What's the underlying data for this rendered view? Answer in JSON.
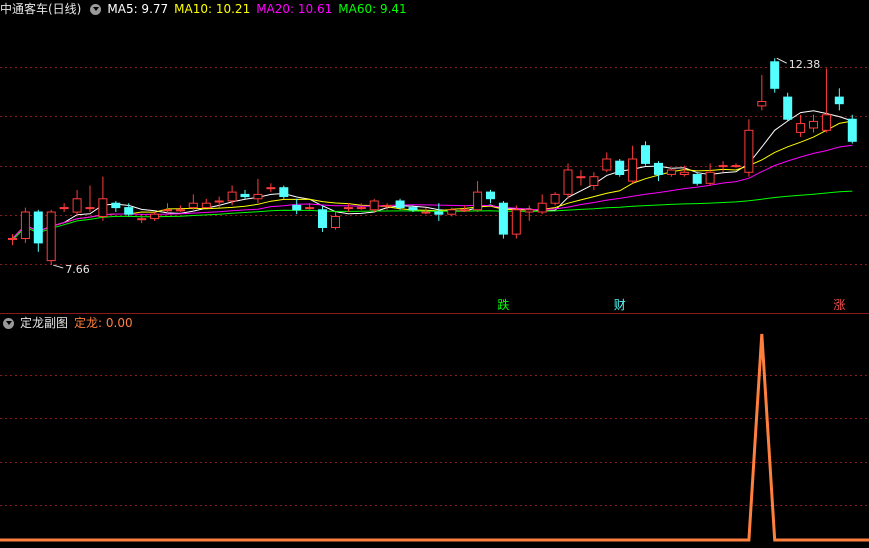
{
  "main_panel": {
    "symbol": "中通客车(日线)",
    "indicators": [
      {
        "label": "MA5: 9.77",
        "color": "#ffffff"
      },
      {
        "label": "MA10: 10.21",
        "color": "#ffff00"
      },
      {
        "label": "MA20: 10.61",
        "color": "#ff00ff"
      },
      {
        "label": "MA60: 9.41",
        "color": "#00ff00"
      }
    ]
  },
  "sub_panel": {
    "title": "定龙副图",
    "value_label": "定龙: 0.00",
    "value_color": "#ff7f3f"
  },
  "colors": {
    "up": "#ff3c3c",
    "down": "#54ffff",
    "grid": "#8a1a1a",
    "ma5": "#ffffff",
    "ma10": "#ffff00",
    "ma20": "#ff00ff",
    "ma60": "#00ff00",
    "sub_line": "#ff7f3f"
  },
  "chart_data": [
    {
      "type": "candlestick",
      "ylim": [
        7.0,
        13.2
      ],
      "series": [
        {
          "values": [
            [
              8.3,
              8.3,
              8.4,
              8.15
            ],
            [
              8.3,
              8.9,
              9.0,
              8.2
            ],
            [
              8.9,
              8.2,
              8.95,
              8.0
            ],
            [
              7.8,
              8.9,
              8.95,
              7.7
            ],
            [
              9.0,
              9.0,
              9.1,
              8.9
            ],
            [
              8.9,
              9.2,
              9.4,
              8.8
            ],
            [
              9.0,
              9.0,
              9.5,
              8.9
            ],
            [
              8.8,
              9.2,
              9.7,
              8.7
            ],
            [
              9.1,
              9.0,
              9.15,
              8.9
            ],
            [
              9.0,
              8.85,
              9.1,
              8.8
            ],
            [
              8.75,
              8.75,
              8.85,
              8.65
            ],
            [
              8.75,
              8.85,
              8.9,
              8.7
            ],
            [
              8.95,
              8.95,
              9.1,
              8.85
            ],
            [
              8.95,
              8.95,
              9.05,
              8.9
            ],
            [
              9.0,
              9.1,
              9.3,
              8.95
            ],
            [
              9.0,
              9.1,
              9.2,
              9.0
            ],
            [
              9.15,
              9.15,
              9.25,
              9.0
            ],
            [
              9.15,
              9.35,
              9.5,
              9.05
            ],
            [
              9.3,
              9.25,
              9.4,
              9.2
            ],
            [
              9.2,
              9.3,
              9.65,
              9.1
            ],
            [
              9.45,
              9.45,
              9.55,
              9.35
            ],
            [
              9.45,
              9.25,
              9.5,
              9.2
            ],
            [
              9.05,
              8.95,
              9.2,
              8.85
            ],
            [
              9.0,
              9.0,
              9.1,
              8.95
            ],
            [
              8.95,
              8.55,
              9.05,
              8.45
            ],
            [
              8.55,
              8.8,
              8.9,
              8.5
            ],
            [
              9.0,
              9.0,
              9.1,
              8.9
            ],
            [
              9.0,
              9.0,
              9.1,
              8.95
            ],
            [
              8.95,
              9.15,
              9.2,
              8.9
            ],
            [
              9.05,
              9.05,
              9.1,
              8.95
            ],
            [
              9.15,
              9.0,
              9.2,
              8.95
            ],
            [
              9.0,
              8.95,
              9.05,
              8.9
            ],
            [
              8.9,
              8.9,
              9.0,
              8.85
            ],
            [
              8.9,
              8.85,
              9.1,
              8.7
            ],
            [
              8.85,
              8.95,
              9.0,
              8.8
            ],
            [
              8.95,
              8.95,
              9.05,
              8.9
            ],
            [
              8.95,
              9.35,
              9.6,
              8.9
            ],
            [
              9.35,
              9.2,
              9.4,
              9.1
            ],
            [
              9.1,
              8.4,
              9.15,
              8.3
            ],
            [
              8.4,
              8.95,
              9.05,
              8.3
            ],
            [
              8.9,
              8.95,
              9.05,
              8.7
            ],
            [
              8.9,
              9.1,
              9.3,
              8.85
            ],
            [
              9.1,
              9.3,
              9.35,
              9.05
            ],
            [
              9.3,
              9.85,
              10.0,
              9.2
            ],
            [
              9.7,
              9.7,
              9.85,
              9.5
            ],
            [
              9.5,
              9.7,
              9.8,
              9.4
            ],
            [
              9.85,
              10.1,
              10.25,
              9.8
            ],
            [
              10.05,
              9.75,
              10.1,
              9.7
            ],
            [
              9.6,
              10.1,
              10.4,
              9.55
            ],
            [
              10.4,
              10.0,
              10.5,
              9.95
            ],
            [
              10.0,
              9.75,
              10.05,
              9.6
            ],
            [
              9.75,
              9.85,
              9.9,
              9.7
            ],
            [
              9.75,
              9.8,
              9.95,
              9.7
            ],
            [
              9.75,
              9.55,
              9.8,
              9.5
            ],
            [
              9.55,
              9.8,
              10.0,
              9.5
            ],
            [
              9.95,
              9.95,
              10.05,
              9.8
            ],
            [
              9.95,
              9.95,
              10.0,
              9.9
            ],
            [
              9.8,
              10.75,
              11.0,
              9.7
            ],
            [
              11.3,
              11.4,
              12.0,
              11.2
            ],
            [
              12.3,
              11.7,
              12.38,
              11.6
            ],
            [
              11.5,
              11.0,
              11.6,
              10.95
            ],
            [
              10.7,
              10.9,
              11.1,
              10.6
            ],
            [
              10.8,
              10.95,
              11.1,
              10.7
            ],
            [
              10.75,
              11.1,
              12.15,
              10.7
            ],
            [
              11.5,
              11.35,
              11.7,
              11.2
            ],
            [
              11.0,
              10.5,
              11.1,
              10.45
            ]
          ]
        }
      ],
      "annotations": [
        "12.38",
        "7.66"
      ],
      "event_labels": [
        {
          "text": "跌",
          "color": "#00ff00",
          "index": 38
        },
        {
          "text": "财",
          "color": "#54ffff",
          "index": 47
        },
        {
          "text": "涨",
          "color": "#ff5050",
          "index": 64
        }
      ]
    },
    {
      "type": "line",
      "ylim": [
        0,
        1
      ],
      "series": [
        {
          "values": [
            0,
            0,
            0,
            0,
            0,
            0,
            0,
            0,
            0,
            0,
            0,
            0,
            0,
            0,
            0,
            0,
            0,
            0,
            0,
            0,
            0,
            0,
            0,
            0,
            0,
            0,
            0,
            0,
            0,
            0,
            0,
            0,
            0,
            0,
            0,
            0,
            0,
            0,
            0,
            0,
            0,
            0,
            0,
            0,
            0,
            0,
            0,
            0,
            0,
            0,
            0,
            0,
            0,
            0,
            0,
            0,
            0,
            0,
            1,
            0,
            0,
            0,
            0,
            0,
            0,
            0
          ]
        }
      ]
    }
  ]
}
